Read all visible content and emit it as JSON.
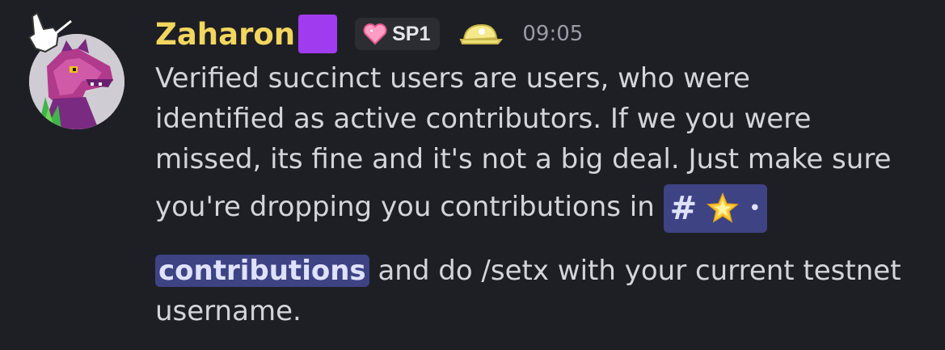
{
  "message": {
    "author": "Zaharon",
    "name_emoji": "purple-square-emoji",
    "role_tag": {
      "icon": "pink-heart-icon",
      "label": "SP1"
    },
    "badge_icon": "yellow-cap-icon",
    "timestamp": "09:05",
    "lines": {
      "l1": "Verified succinct users are users, who were",
      "l2": "identified as active contributors. If we you were",
      "l3": "missed, its fine and it's not a big deal. Just make sure",
      "l4": "you're dropping you contributions in ",
      "l5_rest": " and do /setx with your current testnet",
      "l6": "username."
    },
    "channel_mention": {
      "hash": "#",
      "icon": "glowing-star-icon",
      "separator": "•",
      "name": "contributions"
    }
  },
  "colors": {
    "background": "#1e1f24",
    "username": "#f2d65f",
    "mention_bg": "#3e4384",
    "text": "#d4d5da"
  }
}
